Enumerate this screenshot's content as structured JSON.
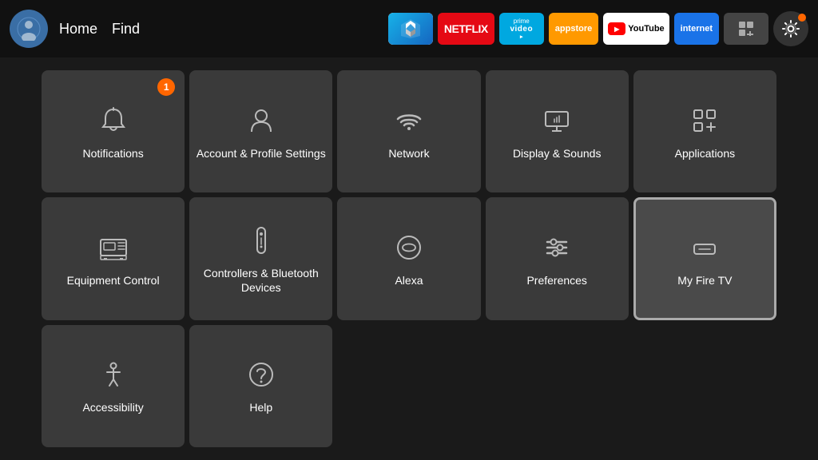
{
  "nav": {
    "links": [
      {
        "label": "Home",
        "name": "home"
      },
      {
        "label": "Find",
        "name": "find"
      }
    ],
    "apps": [
      {
        "label": "KODI",
        "name": "kodi",
        "class": "app-kodi"
      },
      {
        "label": "NETFLIX",
        "name": "netflix",
        "class": "app-netflix"
      },
      {
        "label": "prime video",
        "name": "prime",
        "class": "app-prime"
      },
      {
        "label": "appstore",
        "name": "appstore",
        "class": "app-appstore"
      },
      {
        "label": "YouTube",
        "name": "youtube",
        "class": "app-youtube"
      },
      {
        "label": "internet",
        "name": "internet",
        "class": "app-internet"
      }
    ]
  },
  "grid": {
    "items": [
      {
        "id": "notifications",
        "label": "Notifications",
        "icon": "bell",
        "badge": "1",
        "focused": false
      },
      {
        "id": "account",
        "label": "Account & Profile Settings",
        "icon": "person",
        "badge": null,
        "focused": false
      },
      {
        "id": "network",
        "label": "Network",
        "icon": "wifi",
        "badge": null,
        "focused": false
      },
      {
        "id": "display",
        "label": "Display & Sounds",
        "icon": "display",
        "badge": null,
        "focused": false
      },
      {
        "id": "applications",
        "label": "Applications",
        "icon": "apps",
        "badge": null,
        "focused": false
      },
      {
        "id": "equipment",
        "label": "Equipment Control",
        "icon": "tv",
        "badge": null,
        "focused": false
      },
      {
        "id": "controllers",
        "label": "Controllers & Bluetooth Devices",
        "icon": "remote",
        "badge": null,
        "focused": false
      },
      {
        "id": "alexa",
        "label": "Alexa",
        "icon": "alexa",
        "badge": null,
        "focused": false
      },
      {
        "id": "preferences",
        "label": "Preferences",
        "icon": "sliders",
        "badge": null,
        "focused": false
      },
      {
        "id": "myfiretv",
        "label": "My Fire TV",
        "icon": "firetv",
        "badge": null,
        "focused": true
      },
      {
        "id": "accessibility",
        "label": "Accessibility",
        "icon": "accessibility",
        "badge": null,
        "focused": false
      },
      {
        "id": "help",
        "label": "Help",
        "icon": "help",
        "badge": null,
        "focused": false
      }
    ]
  },
  "colors": {
    "accent": "#ff6600",
    "focused_border": "#aaaaaa",
    "bg_item": "#3a3a3a",
    "bg_focused": "#4a4a4a"
  }
}
